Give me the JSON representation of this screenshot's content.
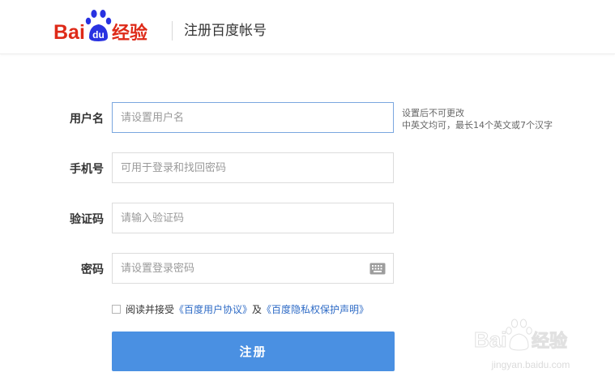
{
  "header": {
    "logo_text": "Bai du 经验",
    "title": "注册百度帐号"
  },
  "form": {
    "username": {
      "label": "用户名",
      "placeholder": "请设置用户名"
    },
    "phone": {
      "label": "手机号",
      "placeholder": "可用于登录和找回密码"
    },
    "code": {
      "label": "验证码",
      "placeholder": "请输入验证码"
    },
    "password": {
      "label": "密码",
      "placeholder": "请设置登录密码"
    }
  },
  "hint": {
    "line1": "设置后不可更改",
    "line2": "中英文均可，最长14个英文或7个汉字"
  },
  "agreement": {
    "prefix": "阅读并接受",
    "link1": "《百度用户协议》",
    "conjunction": "及",
    "link2": "《百度隐私权保护声明》",
    "checked": false
  },
  "submit_label": "注册",
  "watermark": {
    "logo_text": "Baidu 经验",
    "url": "jingyan.baidu.com"
  },
  "colors": {
    "brand_red": "#de2a18",
    "brand_blue": "#2932e1",
    "button_blue": "#4a90e2",
    "link_blue": "#2e6bc6",
    "focus_border": "#7aa7df"
  }
}
